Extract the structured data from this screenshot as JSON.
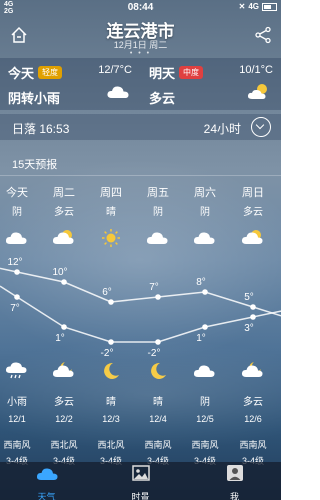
{
  "status": {
    "network_top": "4G",
    "network_bottom": "2G",
    "time": "08:44",
    "right_network": "4G"
  },
  "header": {
    "city": "连云港市",
    "date": "12月1日 周二",
    "page_dots": "• • •"
  },
  "today": {
    "label": "今天",
    "badge": "轻度",
    "badge_color": "#e0a000",
    "range": "12/7°C",
    "condition": "阴转小雨",
    "icon": "cloud-icon"
  },
  "tomorrow": {
    "label": "明天",
    "badge": "中度",
    "badge_color": "#e04040",
    "range": "10/1°C",
    "condition": "多云",
    "icon": "partly-cloudy-icon"
  },
  "sunset": {
    "label": "日落 16:53",
    "hours": "24小时"
  },
  "forecast_title": "15天预报",
  "days": [
    {
      "name": "今天",
      "cond": "阴",
      "icon": "cloud-icon",
      "high": 12,
      "low": 7,
      "night_icon": "rain-cloud-icon",
      "night_cond": "小雨",
      "date": "12/1",
      "wind": "西南风",
      "level": "3-4级"
    },
    {
      "name": "周二",
      "cond": "多云",
      "icon": "partly-cloudy-icon",
      "high": 10,
      "low": 1,
      "night_icon": "partly-cloudy-night-icon",
      "night_cond": "多云",
      "date": "12/2",
      "wind": "西北风",
      "level": "3-4级"
    },
    {
      "name": "周四",
      "cond": "晴",
      "icon": "sun-icon",
      "high": 6,
      "low": -2,
      "night_icon": "moon-icon",
      "night_cond": "晴",
      "date": "12/3",
      "wind": "西北风",
      "level": "3-4级"
    },
    {
      "name": "周五",
      "cond": "阴",
      "icon": "cloud-icon",
      "high": 7,
      "low": -2,
      "night_icon": "moon-icon",
      "night_cond": "晴",
      "date": "12/4",
      "wind": "西南风",
      "level": "3-4级"
    },
    {
      "name": "周六",
      "cond": "阴",
      "icon": "cloud-icon",
      "high": 8,
      "low": 1,
      "night_icon": "cloud-icon",
      "night_cond": "阴",
      "date": "12/5",
      "wind": "西南风",
      "level": "3-4级"
    },
    {
      "name": "周日",
      "cond": "多云",
      "icon": "partly-cloudy-icon",
      "high": 5,
      "low": 3,
      "night_icon": "partly-cloudy-night-icon",
      "night_cond": "多云",
      "date": "12/6",
      "wind": "西南风",
      "level": "3-4级"
    }
  ],
  "tabs": [
    {
      "label": "天气",
      "icon": "weather-icon",
      "active": true
    },
    {
      "label": "时景",
      "icon": "photo-icon",
      "active": false
    },
    {
      "label": "我",
      "icon": "user-icon",
      "active": false
    }
  ]
}
